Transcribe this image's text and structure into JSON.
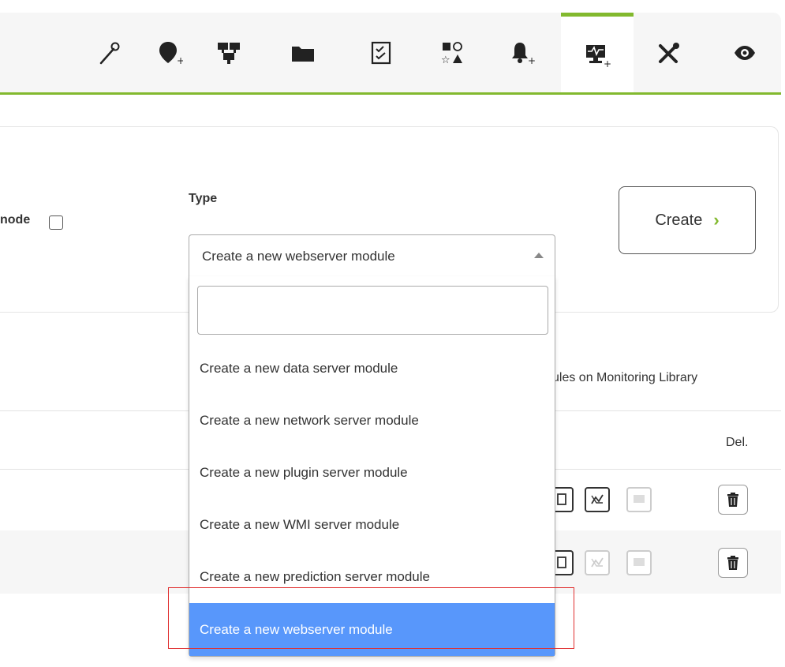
{
  "toolbar": {
    "items": [
      {
        "icon": "wand-icon"
      },
      {
        "icon": "map-marker-plus-icon"
      },
      {
        "icon": "network-agents-icon"
      },
      {
        "icon": "folder-icon"
      },
      {
        "icon": "checklist-icon"
      },
      {
        "icon": "shapes-icon"
      },
      {
        "icon": "bell-plus-icon"
      },
      {
        "icon": "monitor-heartbeat-plus-icon",
        "active": true
      },
      {
        "icon": "tools-icon"
      },
      {
        "icon": "eye-icon"
      }
    ],
    "accent_color": "#82b92e"
  },
  "form": {
    "mode_label": "node",
    "type_label": "Type",
    "create_label": "Create",
    "create_arrow": "›"
  },
  "type_select": {
    "value": "Create a new webserver module",
    "search_value": "",
    "options": [
      "Create a new data server module",
      "Create a new network server module",
      "Create a new plugin server module",
      "Create a new WMI server module",
      "Create a new prediction server module",
      "Create a new webserver module"
    ],
    "selected_index": 5,
    "highlight_color": "#5897fb"
  },
  "modules": {
    "library_link": "ules on Monitoring Library",
    "del_header": "Del."
  }
}
